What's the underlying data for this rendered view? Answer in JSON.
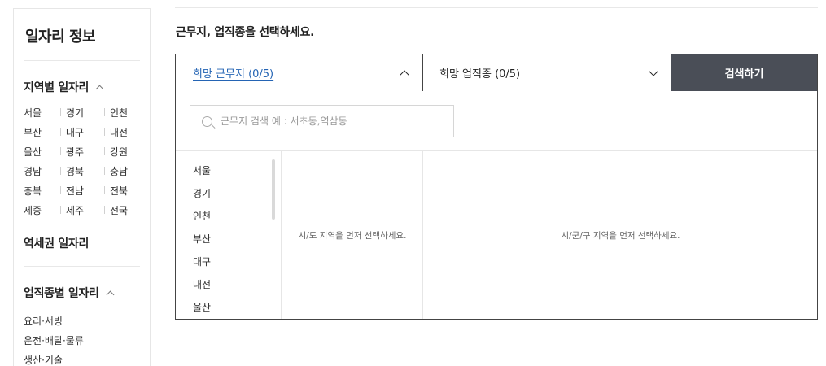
{
  "sidebar": {
    "title": "일자리 정보",
    "region_section": {
      "title": "지역별 일자리",
      "rows": [
        [
          "서울",
          "경기",
          "인천"
        ],
        [
          "부산",
          "대구",
          "대전"
        ],
        [
          "울산",
          "광주",
          "강원"
        ],
        [
          "경남",
          "경북",
          "충남"
        ],
        [
          "충북",
          "전남",
          "전북"
        ],
        [
          "세종",
          "제주",
          "전국"
        ]
      ]
    },
    "station_section": {
      "title": "역세권 일자리"
    },
    "job_section": {
      "title": "업직종별 일자리",
      "items": [
        "요리·서빙",
        "운전·배달·물류",
        "생산·기술"
      ]
    }
  },
  "main": {
    "heading": "근무지, 업직종을 선택하세요.",
    "tabs": {
      "region_label": "희망 근무지 (0/5)",
      "job_label": "희망 업직종 (0/5)"
    },
    "search_button": "검색하기",
    "search": {
      "placeholder": "근무지 검색 예 : 서초동,역삼동"
    },
    "sido_list": [
      "서울",
      "경기",
      "인천",
      "부산",
      "대구",
      "대전",
      "울산"
    ],
    "sigungu_message": "시/도 지역을 먼저 선택하세요.",
    "dong_message": "시/군/구 지역을 먼저 선택하세요."
  }
}
